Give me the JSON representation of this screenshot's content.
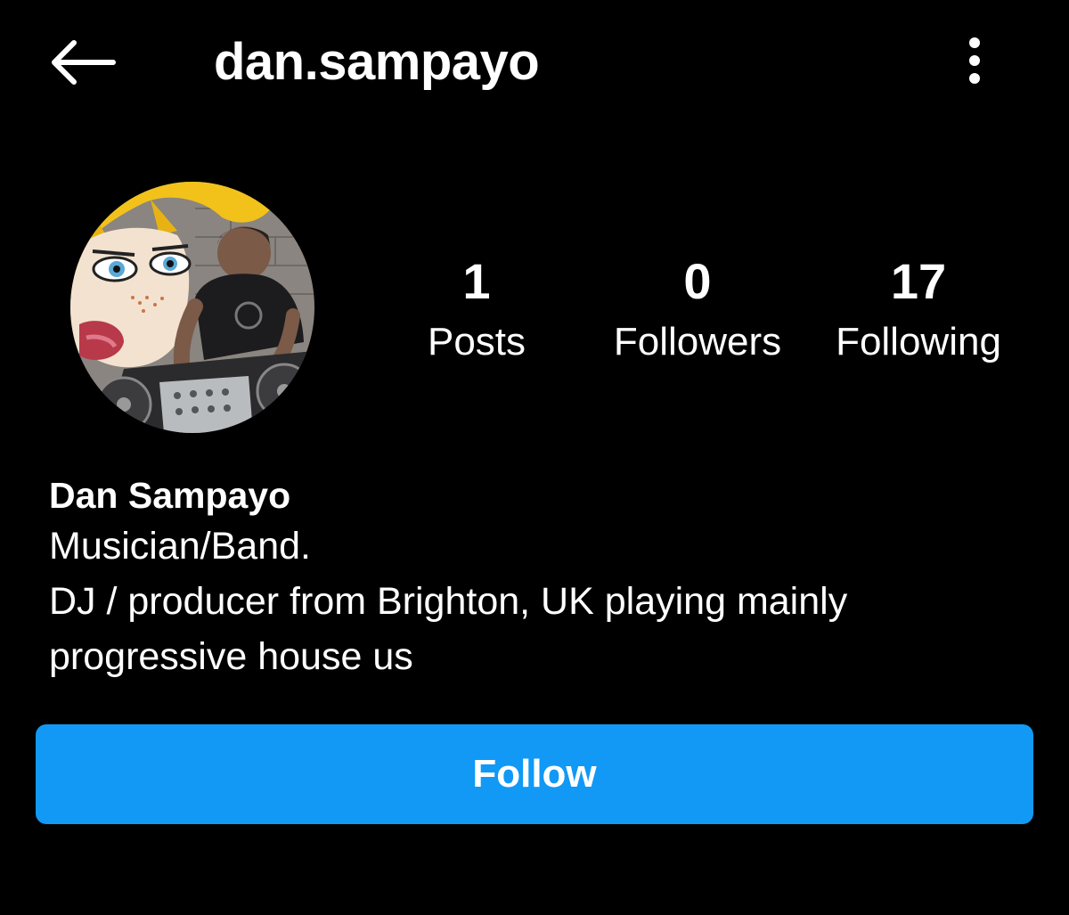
{
  "header": {
    "back_icon": "arrow-left-icon",
    "username": "dan.sampayo",
    "more_icon": "vertical-ellipsis-icon"
  },
  "profile": {
    "avatar_icon": "profile-photo",
    "stats": {
      "posts": {
        "count": "1",
        "label": "Posts"
      },
      "followers": {
        "count": "0",
        "label": "Followers"
      },
      "following": {
        "count": "17",
        "label": "Following"
      }
    },
    "display_name": "Dan Sampayo",
    "category": "Musician/Band.",
    "bio": "DJ / producer from Brighton, UK playing mainly progressive house us"
  },
  "actions": {
    "follow_label": "Follow",
    "follow_color": "#1199f5"
  },
  "theme": {
    "background": "#000000",
    "text": "#ffffff"
  }
}
